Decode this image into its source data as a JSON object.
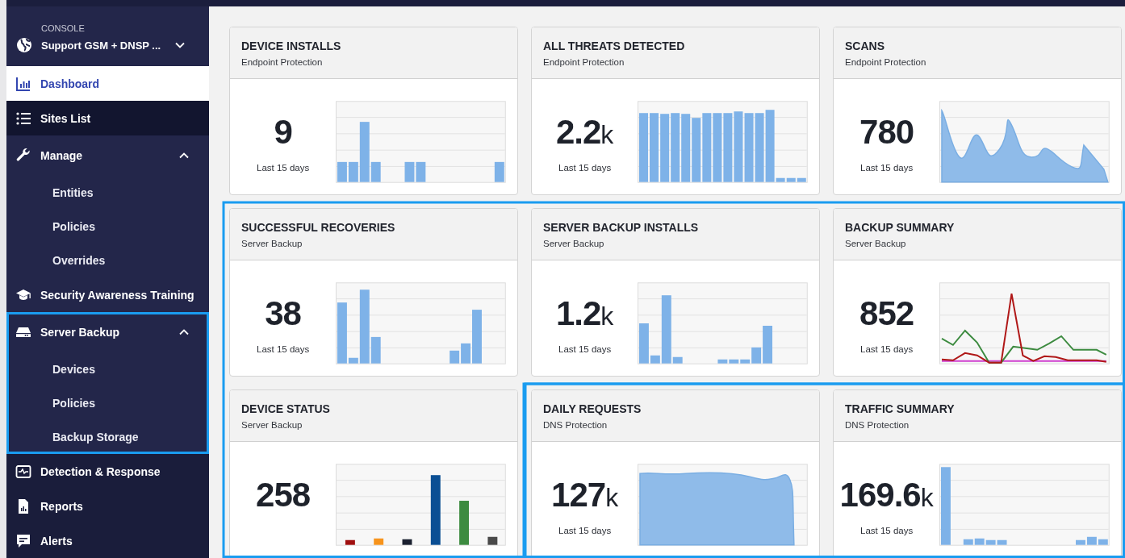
{
  "sidebar": {
    "console_label": "CONSOLE",
    "site_name": "Support GSM + DNSP ...",
    "site_menu_expanded": false,
    "items": [
      {
        "label": "Dashboard",
        "selected": true,
        "hovered": false,
        "highlighted": false
      },
      {
        "label": "Sites List",
        "selected": false,
        "hovered": true,
        "highlighted": false
      },
      {
        "label": "Manage",
        "selected": false,
        "hovered": false,
        "highlighted": false,
        "expanded": true,
        "children": [
          {
            "label": "Entities"
          },
          {
            "label": "Policies"
          },
          {
            "label": "Overrides"
          }
        ]
      },
      {
        "label": "Security Awareness Training",
        "selected": false,
        "hovered": false,
        "highlighted": false
      },
      {
        "label": "Server Backup",
        "selected": false,
        "hovered": false,
        "highlighted": true,
        "expanded": true,
        "children": [
          {
            "label": "Devices"
          },
          {
            "label": "Policies"
          },
          {
            "label": "Backup Storage"
          }
        ]
      },
      {
        "label": "Detection & Response",
        "selected": false,
        "hovered": false,
        "highlighted": false
      },
      {
        "label": "Reports",
        "selected": false,
        "hovered": false,
        "highlighted": false
      },
      {
        "label": "Alerts",
        "selected": false,
        "hovered": false,
        "highlighted": false
      }
    ]
  },
  "card_sections": [
    {
      "highlighted": false,
      "cards": [
        {
          "title": "DEVICE INSTALLS",
          "subtitle": "Endpoint Protection",
          "value": "9",
          "period": "Last 15 days"
        },
        {
          "title": "ALL THREATS DETECTED",
          "subtitle": "Endpoint Protection",
          "value": "2.2",
          "unit": "k",
          "period": "Last 15 days"
        },
        {
          "title": "SCANS",
          "subtitle": "Endpoint Protection",
          "value": "780",
          "period": "Last 15 days"
        }
      ]
    },
    {
      "highlighted": true,
      "cards": [
        {
          "title": "SUCCESSFUL RECOVERIES",
          "subtitle": "Server Backup",
          "value": "38",
          "period": "Last 15 days"
        },
        {
          "title": "SERVER BACKUP INSTALLS",
          "subtitle": "Server Backup",
          "value": "1.2",
          "unit": "k",
          "period": "Last 15 days"
        },
        {
          "title": "BACKUP SUMMARY",
          "subtitle": "Server Backup",
          "value": "852",
          "period": "Last 15 days"
        },
        {
          "title": "DEVICE STATUS",
          "subtitle": "Server Backup",
          "value": "258"
        }
      ]
    },
    {
      "highlighted": true,
      "cards": [
        {
          "title": "DAILY REQUESTS",
          "subtitle": "DNS Protection",
          "value": "127",
          "unit": "k",
          "period": "Last 15 days"
        },
        {
          "title": "TRAFFIC SUMMARY",
          "subtitle": "DNS Protection",
          "value": "169.6",
          "unit": "k",
          "period": "Last 15 days"
        }
      ]
    }
  ]
}
